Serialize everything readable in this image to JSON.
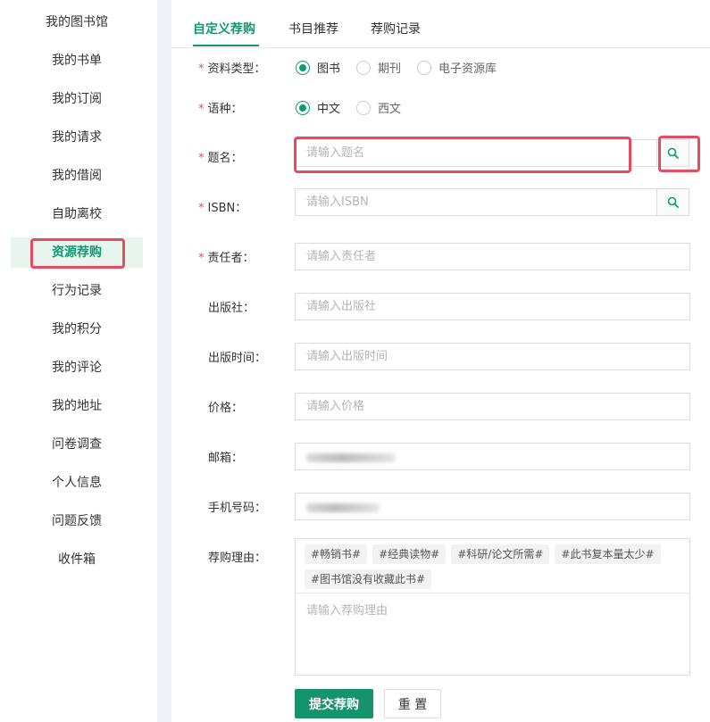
{
  "sidebar": {
    "items": [
      {
        "label": "我的图书馆"
      },
      {
        "label": "我的书单"
      },
      {
        "label": "我的订阅"
      },
      {
        "label": "我的请求"
      },
      {
        "label": "我的借阅"
      },
      {
        "label": "自助离校"
      },
      {
        "label": "资源荐购"
      },
      {
        "label": "行为记录"
      },
      {
        "label": "我的积分"
      },
      {
        "label": "我的评论"
      },
      {
        "label": "我的地址"
      },
      {
        "label": "问卷调查"
      },
      {
        "label": "个人信息"
      },
      {
        "label": "问题反馈"
      },
      {
        "label": "收件箱"
      }
    ],
    "active_index": 6
  },
  "tabs": [
    {
      "label": "自定义荐购",
      "active": true
    },
    {
      "label": "书目推荐",
      "active": false
    },
    {
      "label": "荐购记录",
      "active": false
    }
  ],
  "form": {
    "required_mark": "*",
    "type": {
      "label": "资料类型：",
      "options": [
        {
          "label": "图书",
          "checked": true
        },
        {
          "label": "期刊",
          "checked": false
        },
        {
          "label": "电子资源库",
          "checked": false
        }
      ]
    },
    "language": {
      "label": "语种：",
      "options": [
        {
          "label": "中文",
          "checked": true
        },
        {
          "label": "西文",
          "checked": false
        }
      ]
    },
    "title": {
      "label": "题名：",
      "placeholder": "请输入题名"
    },
    "isbn": {
      "label": "ISBN：",
      "placeholder": "请输入ISBN"
    },
    "author": {
      "label": "责任者：",
      "placeholder": "请输入责任者"
    },
    "publisher": {
      "label": "出版社：",
      "placeholder": "请输入出版社"
    },
    "pub_date": {
      "label": "出版时间：",
      "placeholder": "请输入出版时间"
    },
    "price": {
      "label": "价格：",
      "placeholder": "请输入价格"
    },
    "email": {
      "label": "邮箱："
    },
    "phone": {
      "label": "手机号码："
    },
    "reason": {
      "label": "荐购理由：",
      "tags": [
        "#畅销书#",
        "#经典读物#",
        "#科研/论文所需#",
        "#此书复本量太少#",
        "#图书馆没有收藏此书#"
      ],
      "placeholder": "请输入荐购理由"
    },
    "submit_label": "提交荐购",
    "reset_label": "重 置"
  },
  "colors": {
    "accent": "#0f9b72",
    "highlight": "#e84a5f",
    "required": "#e84a5f"
  }
}
